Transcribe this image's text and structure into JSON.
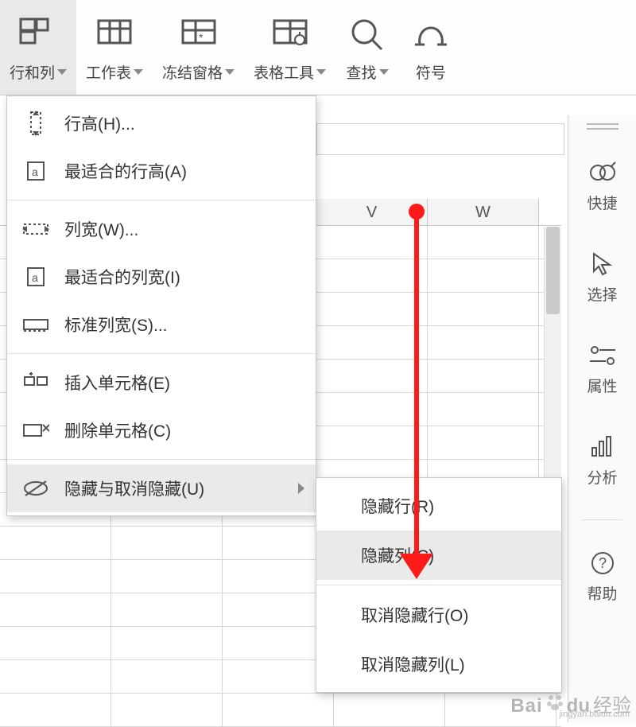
{
  "toolbar": {
    "items": [
      {
        "label": "行和列",
        "icon": "rows-cols-icon",
        "has_caret": true,
        "active": true
      },
      {
        "label": "工作表",
        "icon": "worksheet-icon",
        "has_caret": true
      },
      {
        "label": "冻结窗格",
        "icon": "freeze-panes-icon",
        "has_caret": true
      },
      {
        "label": "表格工具",
        "icon": "table-tools-icon",
        "has_caret": true
      },
      {
        "label": "查找",
        "icon": "search-icon",
        "has_caret": true
      },
      {
        "label": "符号",
        "icon": "symbol-icon",
        "has_caret": false
      }
    ]
  },
  "menu": {
    "groups": [
      [
        {
          "label": "行高(H)...",
          "icon": "row-height-icon"
        },
        {
          "label": "最适合的行高(A)",
          "icon": "autofit-row-icon"
        }
      ],
      [
        {
          "label": "列宽(W)...",
          "icon": "col-width-icon"
        },
        {
          "label": "最适合的列宽(I)",
          "icon": "autofit-col-icon"
        },
        {
          "label": "标准列宽(S)...",
          "icon": "std-col-width-icon"
        }
      ],
      [
        {
          "label": "插入单元格(E)",
          "icon": "insert-cells-icon"
        },
        {
          "label": "删除单元格(C)",
          "icon": "delete-cells-icon"
        }
      ],
      [
        {
          "label": "隐藏与取消隐藏(U)",
          "icon": "hide-unhide-icon",
          "submenu": true,
          "hover": true
        }
      ]
    ]
  },
  "submenu": {
    "groups": [
      [
        {
          "label": "隐藏行(R)"
        },
        {
          "label": "隐藏列(C)",
          "hover": true
        }
      ],
      [
        {
          "label": "取消隐藏行(O)"
        },
        {
          "label": "取消隐藏列(L)"
        }
      ]
    ]
  },
  "grid": {
    "columns": [
      "V",
      "W"
    ]
  },
  "side_panel": {
    "items": [
      {
        "label": "快捷",
        "icon": "shortcut-icon"
      },
      {
        "label": "选择",
        "icon": "select-icon"
      },
      {
        "label": "属性",
        "icon": "properties-icon"
      },
      {
        "label": "分析",
        "icon": "analyze-icon"
      },
      {
        "label": "帮助",
        "icon": "help-icon"
      }
    ]
  },
  "watermark": {
    "brand": "Baidu",
    "text": "经验",
    "url": "jingyan.baidu.com"
  }
}
